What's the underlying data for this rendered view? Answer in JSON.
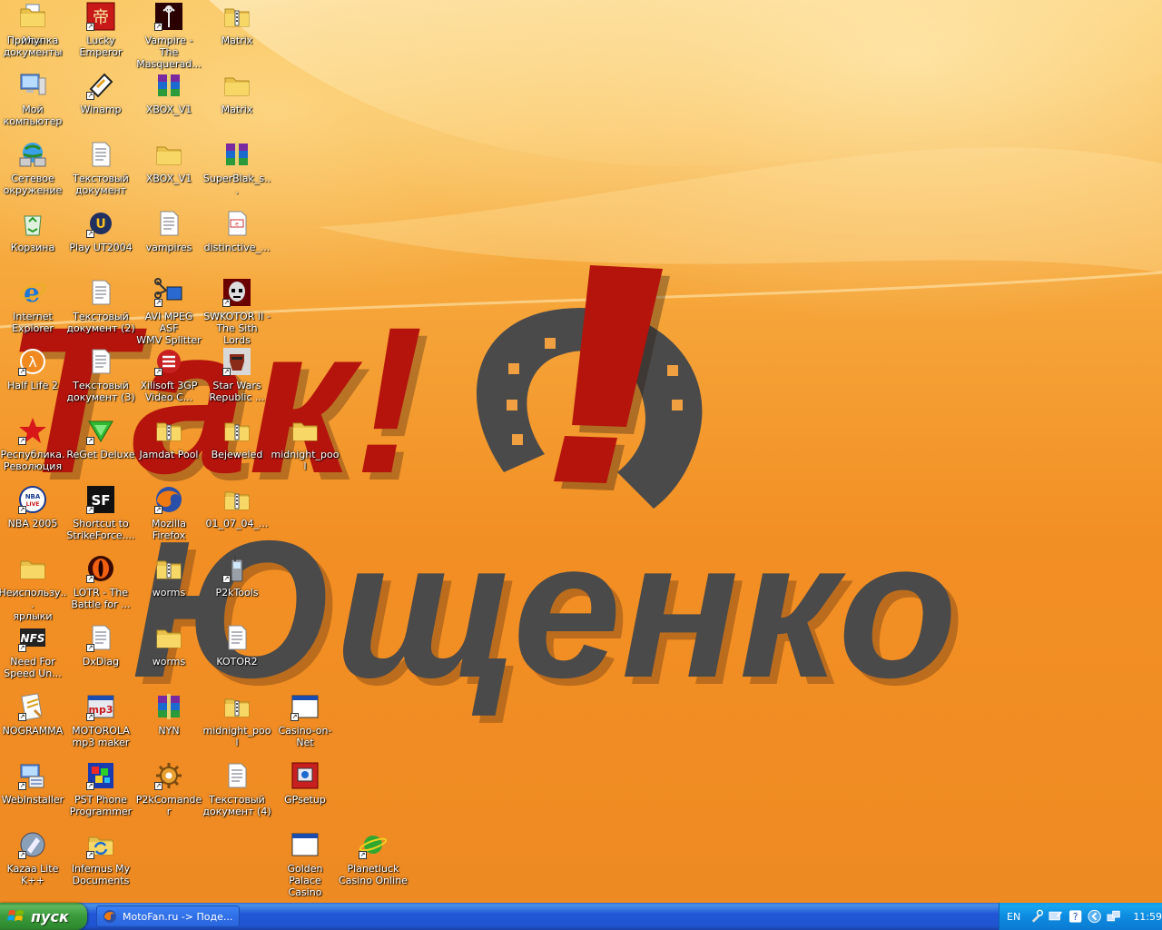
{
  "wallpaper": {
    "line1": "Так!",
    "line2": "Ющенко",
    "red": "#b4140c",
    "gray": "#4a4a4a"
  },
  "icons": [
    {
      "id": "moi-dokumenty",
      "label": "Мои\nдокументы",
      "icon": "folder-docs",
      "shortcut": false
    },
    {
      "id": "moi-kompyuter",
      "label": "Мой\nкомпьютер",
      "icon": "computer",
      "shortcut": false
    },
    {
      "id": "setevoe",
      "label": "Сетевое\nокружение",
      "icon": "network",
      "shortcut": false
    },
    {
      "id": "korzina",
      "label": "Корзина",
      "icon": "recycle-bin",
      "shortcut": false
    },
    {
      "id": "ie",
      "label": "Internet\nExplorer",
      "icon": "ie",
      "shortcut": false
    },
    {
      "id": "half-life-2",
      "label": "Half Life 2",
      "icon": "half-life",
      "shortcut": true
    },
    {
      "id": "respublika",
      "label": "Республика.\nРеволюция",
      "icon": "red-star",
      "shortcut": true
    },
    {
      "id": "nba-2005",
      "label": "NBA 2005",
      "icon": "nba",
      "shortcut": true
    },
    {
      "id": "neispolz",
      "label": "Неиспользу...\nярлыки",
      "icon": "folder",
      "shortcut": false
    },
    {
      "id": "nfs",
      "label": "Need For\nSpeed Un...",
      "icon": "nfs",
      "shortcut": true
    },
    {
      "id": "nogramma",
      "label": "NOGRAMMA",
      "icon": "nogramma",
      "shortcut": true
    },
    {
      "id": "webinstaller",
      "label": "WebInstaller",
      "icon": "installer",
      "shortcut": true
    },
    {
      "id": "kazaa",
      "label": "Kazaa Lite\nK++",
      "icon": "kazaa",
      "shortcut": true
    },
    {
      "id": "lucky-emperor",
      "label": "Lucky Emperor",
      "icon": "lucky-emperor",
      "shortcut": true
    },
    {
      "id": "winamp",
      "label": "Winamp",
      "icon": "winamp",
      "shortcut": true
    },
    {
      "id": "txt-doc",
      "label": "Текстовый\nдокумент",
      "icon": "text-document",
      "shortcut": false
    },
    {
      "id": "play-ut2004",
      "label": "Play UT2004",
      "icon": "ut2004",
      "shortcut": true
    },
    {
      "id": "txt-doc-2",
      "label": "Текстовый\nдокумент (2)",
      "icon": "text-document",
      "shortcut": false
    },
    {
      "id": "txt-doc-3",
      "label": "Текстовый\nдокумент (3)",
      "icon": "text-document",
      "shortcut": false
    },
    {
      "id": "reget",
      "label": "ReGet Deluxe",
      "icon": "reget",
      "shortcut": true
    },
    {
      "id": "strikeforce",
      "label": "Shortcut to\nStrikeForce....",
      "icon": "strikeforce",
      "shortcut": true
    },
    {
      "id": "lotr",
      "label": "LOTR - The\nBattle for ...",
      "icon": "lotr",
      "shortcut": true
    },
    {
      "id": "dxdiag",
      "label": "DxDiag",
      "icon": "text-document",
      "shortcut": true
    },
    {
      "id": "motorola-mp3",
      "label": "MOTOROLA\nmp3 maker",
      "icon": "mp3-maker",
      "shortcut": true
    },
    {
      "id": "pst-phone",
      "label": "PST Phone\nProgrammer",
      "icon": "pst-phone",
      "shortcut": true
    },
    {
      "id": "infernus",
      "label": "Infernus My\nDocuments",
      "icon": "folder-sync",
      "shortcut": true
    },
    {
      "id": "vampire",
      "label": "Vampire - The\nMasquerad...",
      "icon": "vampire",
      "shortcut": true
    },
    {
      "id": "xbox-v1-rar",
      "label": "XBOX_V1",
      "icon": "winrar",
      "shortcut": false
    },
    {
      "id": "xbox-v1-folder",
      "label": "XBOX_V1",
      "icon": "folder",
      "shortcut": false
    },
    {
      "id": "vampires",
      "label": "vampires",
      "icon": "text-document",
      "shortcut": false
    },
    {
      "id": "avi-splitter",
      "label": "AVI MPEG ASF\nWMV Splitter",
      "icon": "splitter",
      "shortcut": true
    },
    {
      "id": "xilisoft",
      "label": "Xilisoft 3GP\nVideo C...",
      "icon": "xilisoft",
      "shortcut": true
    },
    {
      "id": "jamdat",
      "label": "Jamdat Pool",
      "icon": "zip-folder",
      "shortcut": false
    },
    {
      "id": "firefox",
      "label": "Mozilla Firefox",
      "icon": "firefox",
      "shortcut": true
    },
    {
      "id": "worms-zip",
      "label": "worms",
      "icon": "zip-folder",
      "shortcut": false
    },
    {
      "id": "worms-folder",
      "label": "worms",
      "icon": "folder",
      "shortcut": false
    },
    {
      "id": "nyn",
      "label": "NYN",
      "icon": "winrar",
      "shortcut": false
    },
    {
      "id": "p2kcomander",
      "label": "P2kComander",
      "icon": "gear",
      "shortcut": true
    },
    {
      "id": "matrix-zip",
      "label": "Matrix",
      "icon": "zip-folder",
      "shortcut": false
    },
    {
      "id": "matrix-folder",
      "label": "Matrix",
      "icon": "folder",
      "shortcut": false
    },
    {
      "id": "superblak",
      "label": "SuperBlak_s...",
      "icon": "winrar",
      "shortcut": false
    },
    {
      "id": "distinctive",
      "label": "distinctive_...",
      "icon": "web-page",
      "shortcut": false
    },
    {
      "id": "swkotor2",
      "label": "SWKOTOR II -\nThe Sith Lords",
      "icon": "kotor",
      "shortcut": true
    },
    {
      "id": "star-wars",
      "label": "Star Wars\nRepublic ...",
      "icon": "star-wars",
      "shortcut": true
    },
    {
      "id": "bejeweled",
      "label": "Bejeweled",
      "icon": "zip-folder",
      "shortcut": false
    },
    {
      "id": "01-07-04",
      "label": "01_07_04_...",
      "icon": "zip-folder",
      "shortcut": false
    },
    {
      "id": "p2ktools",
      "label": "P2kTools",
      "icon": "phone",
      "shortcut": true
    },
    {
      "id": "kotor2",
      "label": "KOTOR2",
      "icon": "text-document",
      "shortcut": false
    },
    {
      "id": "midnight-pool-zip",
      "label": "midnight_pool",
      "icon": "zip-folder",
      "shortcut": false
    },
    {
      "id": "txt-doc-4",
      "label": "Текстовый\nдокумент (4)",
      "icon": "text-document",
      "shortcut": false
    },
    {
      "id": "midnight-pool-folder",
      "label": "midnight_pool",
      "icon": "folder",
      "shortcut": false
    },
    {
      "id": "casino-on-net",
      "label": "Casino-on-Net",
      "icon": "app-window",
      "shortcut": true
    },
    {
      "id": "gpsetup",
      "label": "GPsetup",
      "icon": "gpsetup",
      "shortcut": false
    },
    {
      "id": "golden-palace",
      "label": "Golden Palace\nCasino",
      "icon": "app-window",
      "shortcut": false
    },
    {
      "id": "planetluck",
      "label": "Planetluck\nCasino Online",
      "icon": "planetluck",
      "shortcut": true
    },
    {
      "id": "prilupka",
      "label": "Прилупка",
      "icon": "folder",
      "shortcut": false
    }
  ],
  "taskbar": {
    "start_label": "пуск",
    "task_label": "MotoFan.ru -> Поде...",
    "lang": "EN",
    "clock": "11:59"
  },
  "colors": {
    "taskbar_blue": "#2054d0",
    "start_green": "#3a9a3a",
    "tray_blue": "#0d8be0"
  }
}
